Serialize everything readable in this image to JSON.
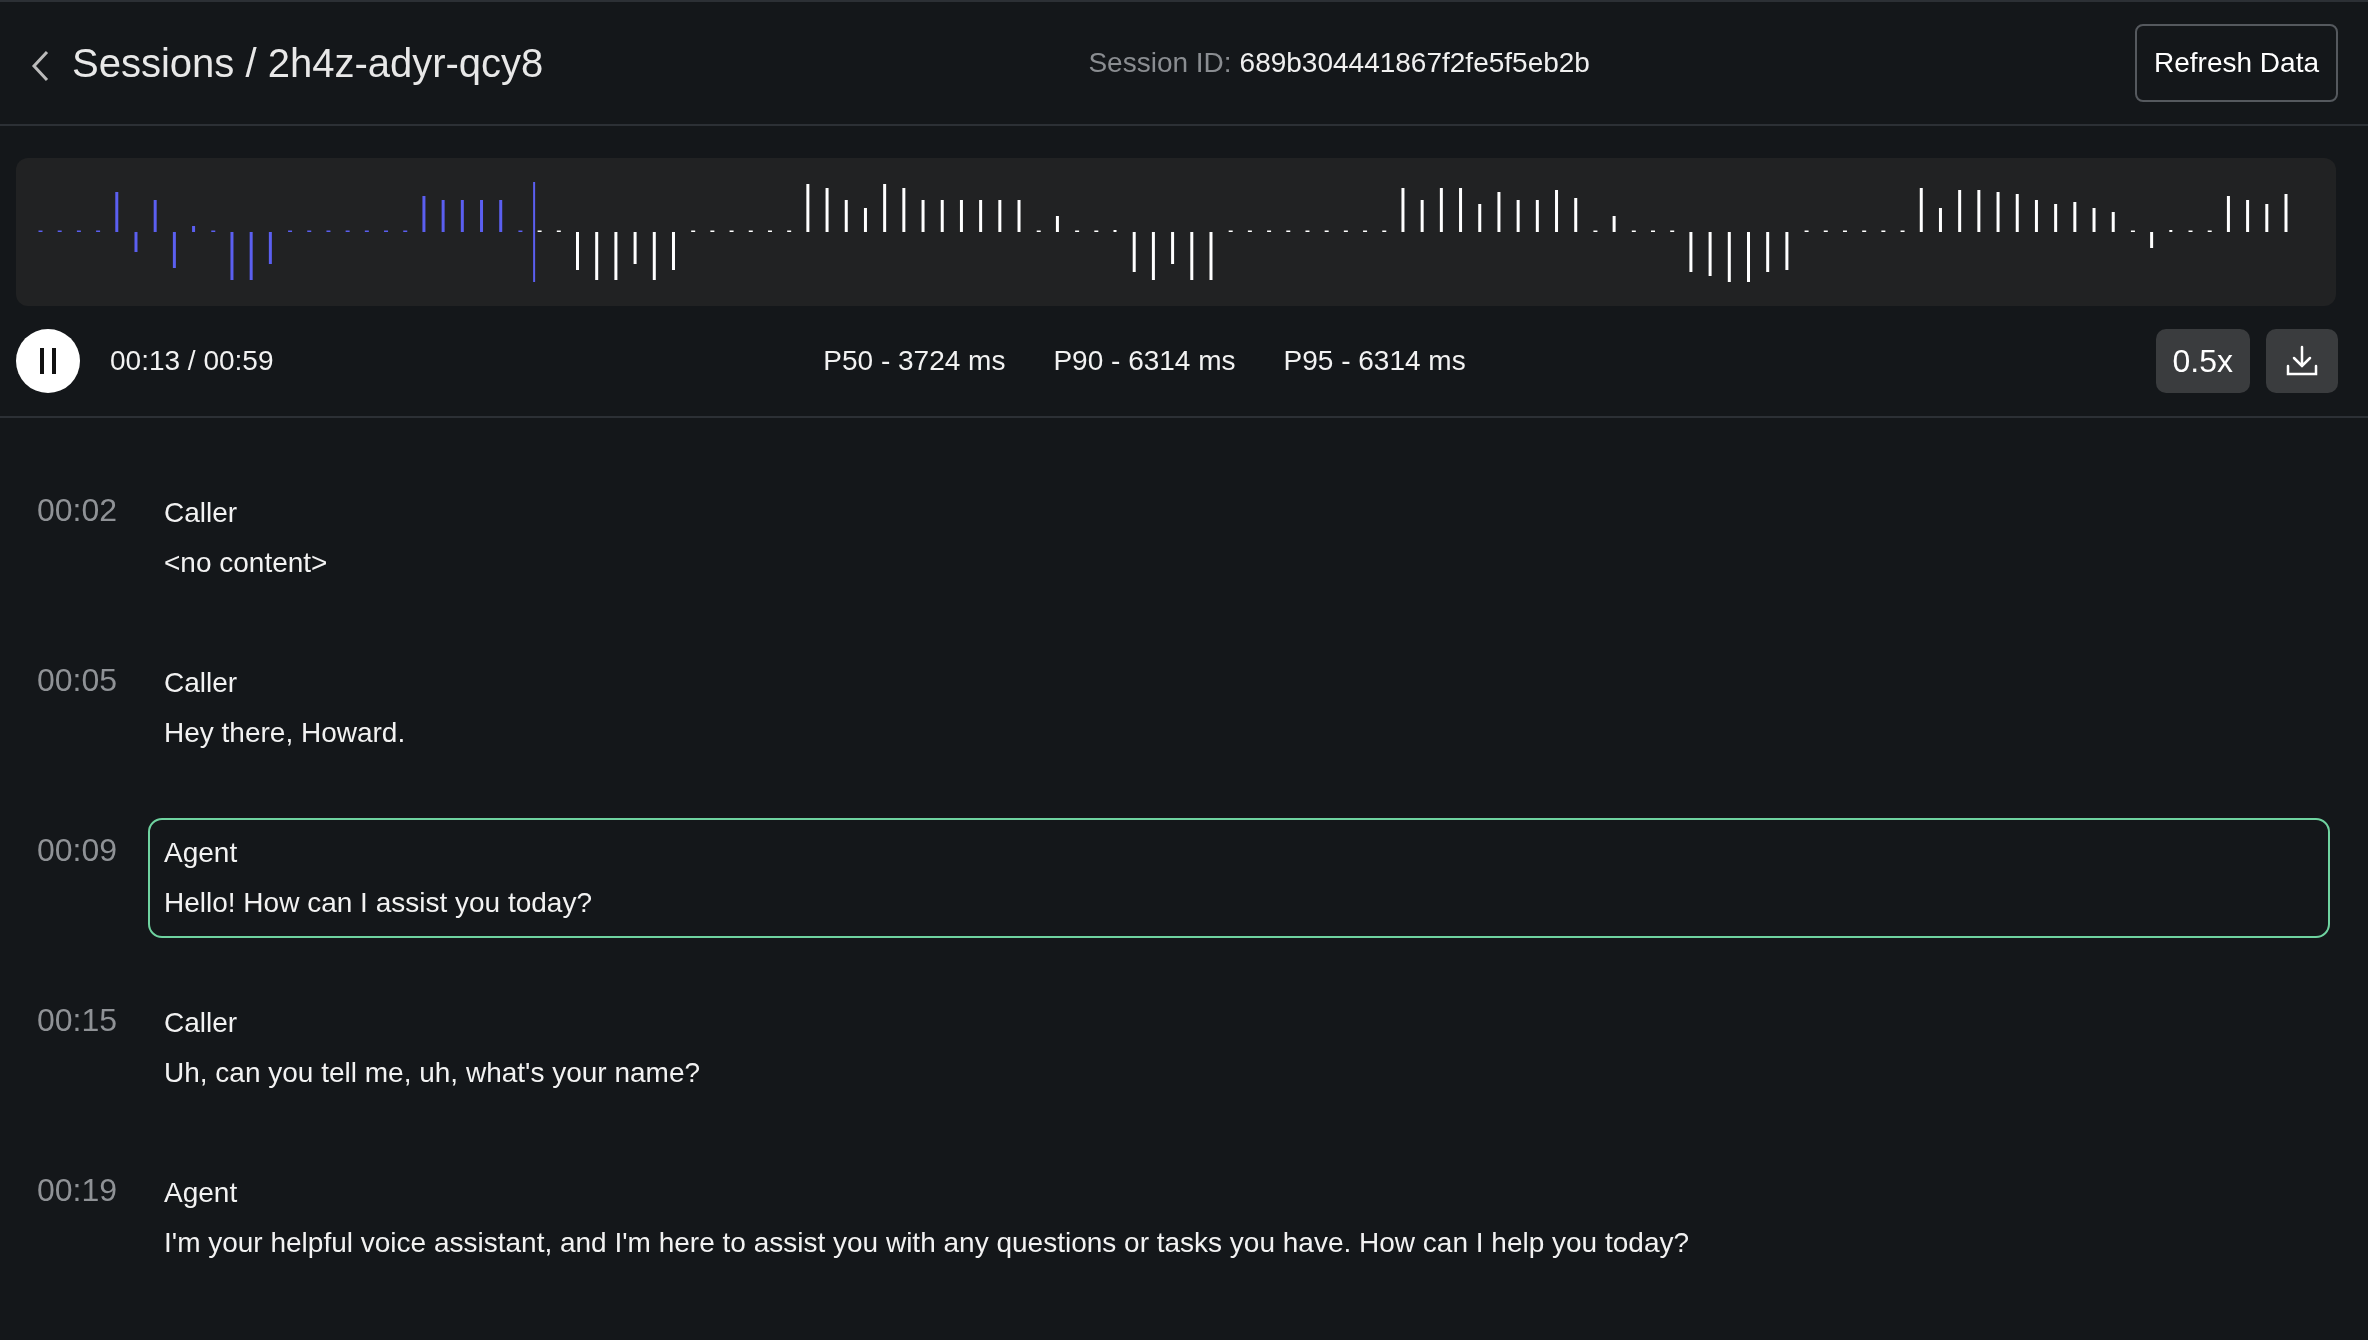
{
  "header": {
    "title": "Sessions / 2h4z-adyr-qcy8",
    "session_label": "Session ID:",
    "session_id": "689b304441867f2fe5f5eb2b",
    "refresh_button": "Refresh Data"
  },
  "player": {
    "playing": true,
    "level": 0.22,
    "time": "00:13 / 00:59",
    "stats": [
      "P50 - 3724 ms",
      "P90 - 6314 ms",
      "P95 - 6314 ms"
    ],
    "speed": "0.5x"
  },
  "transcript": [
    {
      "time": "00:02",
      "speaker": "Caller",
      "text": "<no content>",
      "selected": false
    },
    {
      "time": "00:05",
      "speaker": "Caller",
      "text": "Hey there, Howard.",
      "selected": false
    },
    {
      "time": "00:09",
      "speaker": "Agent",
      "text": "Hello! How can I assist you today?",
      "selected": true
    },
    {
      "time": "00:15",
      "speaker": "Caller",
      "text": "Uh, can you tell me, uh, what's your name?",
      "selected": false
    },
    {
      "time": "00:19",
      "speaker": "Agent",
      "text": "I'm your helpful voice assistant, and I'm here to assist you with any questions or tasks you have. How can I help you today?",
      "selected": false
    }
  ]
}
